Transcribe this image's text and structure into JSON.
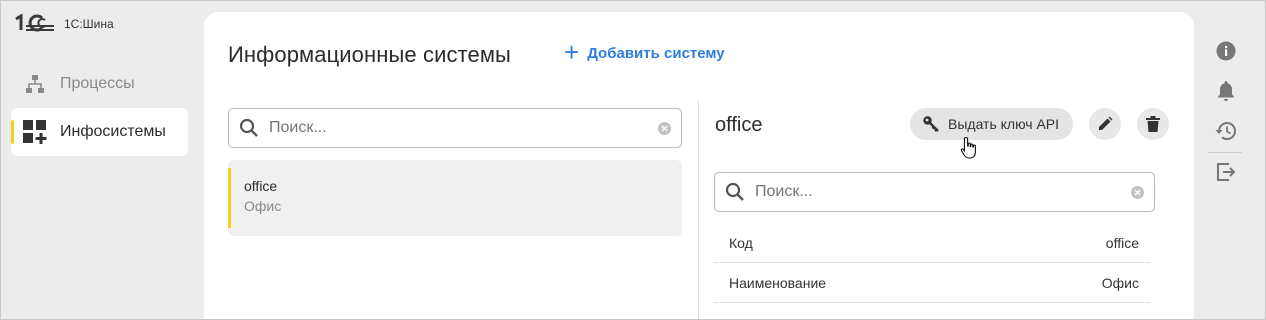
{
  "app": {
    "logo_text": "1С:Шина"
  },
  "sidebar": {
    "items": [
      {
        "label": "Процессы",
        "icon": "hierarchy-icon",
        "active": false
      },
      {
        "label": "Инфосистемы",
        "icon": "apps-add-icon",
        "active": true
      }
    ]
  },
  "main": {
    "title": "Информационные системы",
    "add_label": "Добавить систему",
    "search": {
      "placeholder": "Поиск...",
      "value": ""
    },
    "list": [
      {
        "code": "office",
        "name": "Офис",
        "selected": true
      }
    ]
  },
  "detail": {
    "title": "office",
    "api_button_label": "Выдать ключ API",
    "search": {
      "placeholder": "Поиск...",
      "value": ""
    },
    "properties": [
      {
        "key": "Код",
        "value": "office"
      },
      {
        "key": "Наименование",
        "value": "Офис"
      }
    ]
  },
  "toolbar_right": {
    "icons": [
      "info-icon",
      "bell-icon",
      "history-icon",
      "exit-icon"
    ]
  },
  "colors": {
    "accent": "#f5d21a",
    "link": "#2f7de1",
    "background": "#ececec",
    "panel": "#ffffff"
  }
}
